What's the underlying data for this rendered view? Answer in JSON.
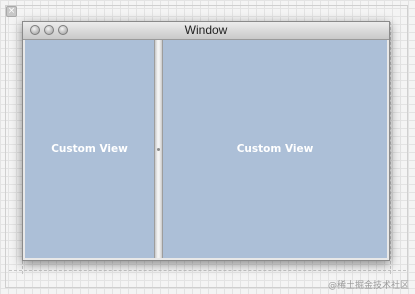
{
  "window": {
    "title": "Window",
    "buttons": [
      "close-button",
      "minimize-button",
      "zoom-button"
    ]
  },
  "panes": {
    "left_label": "Custom View",
    "right_label": "Custom View"
  },
  "canvas": {
    "close_icon": "close-icon",
    "close_glyph": "×"
  },
  "watermark": "@稀土掘金技术社区",
  "colors": {
    "pane_background": "#acbfd7",
    "pane_text": "#ffffff",
    "canvas_background": "#f4f4f4"
  }
}
